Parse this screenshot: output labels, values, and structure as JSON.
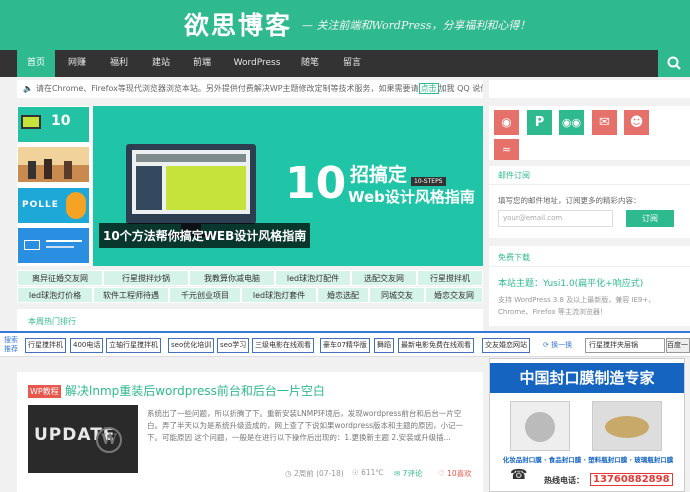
{
  "header": {
    "logo": "欲思博客",
    "slogan": "— 关注前端和WordPress，分享福利和心得！"
  },
  "nav": {
    "items": [
      "首页",
      "网赚",
      "福利",
      "建站",
      "前端",
      "WordPress",
      "随笔",
      "留言"
    ]
  },
  "notice": {
    "text": "请在Chrome、Firefox等现代浏览器浏览本站。另外提供付费解决WP主题修改定制等技术服务，如果需要请",
    "qq_label": "点击",
    "text_after": "加我 QQ 说你的需求。"
  },
  "slide": {
    "number": "10",
    "headline": "招搞定",
    "badge": "10-STEPS",
    "subline": "Web设计风格指南",
    "caption": "10个方法帮你搞定WEB设计风格指南"
  },
  "thumb_label": "POLLE",
  "tags": [
    [
      "离异征婚交友网",
      "行星搅拌炒锅",
      "我教算你减电脑",
      "led球泡灯配件",
      "选配交友网",
      "行星搅拌机"
    ],
    [
      "led球泡灯价格",
      "软件工程师待遇",
      "千元创业项目",
      "led球泡灯套件",
      "婚恋选配",
      "同城交友",
      "婚恋交友网"
    ]
  ],
  "hot": {
    "title": "本周热门排行"
  },
  "subscribe": {
    "title": "邮件订阅",
    "desc": "填写您的邮件地址，订阅更多的精彩内容：",
    "placeholder": "your@email.com",
    "button": "订阅"
  },
  "download": {
    "title": "免费下载",
    "theme": "本站主题：Yusi1.0(扁平化+响应式)",
    "desc": "支持 WordPress 3.8 及以上最新版，兼容 IE9+、Chrome、Firefox 等主流浏览器！"
  },
  "searchbar": {
    "label1": "搜索",
    "label2": "推荐",
    "buttons": [
      "行星搅拌机",
      "400电话",
      "立轴行星搅拌机",
      "seo优化培训",
      "seo学习",
      "三级电影在线观看",
      "豪车07精华版",
      "舞蹈",
      "最新电影免费在线观看",
      "交友婚恋网站"
    ],
    "refresh": "换一换",
    "input_value": "行星搅拌夹层锅",
    "search_button": "百度一"
  },
  "post": {
    "category": "WP教程",
    "title": "解决lnmp重装后wordpress前台和后台一片空白",
    "img_text": "UPDATE",
    "excerpt": "系统出了一些问题，所以折腾了下。重新安装LNMP环境后，发现wordpress前台和后台一片空白。弄了半天以为是系统升级造成的，网上查了下说如果wordpress版本和主题的原因，小记一下。可能原因 这个问题，一般是在进行以下操作后出现的：1.更换新主题 2.安装或升级插...",
    "date": "2周前 (07-18)",
    "views": "611℃",
    "comments": "7评论",
    "likes": "10喜欢"
  },
  "ad": {
    "title": "中国封口膜制造专家",
    "labels": "化妆品封口膜 · 食品封口膜 · 塑料瓶封口膜 · 玻璃瓶封口膜",
    "phone_label": "热线电话：",
    "phone": "13760882898"
  },
  "colors": {
    "brand": "#2fb98e",
    "nav": "#333333",
    "accent": "#e8584d"
  }
}
